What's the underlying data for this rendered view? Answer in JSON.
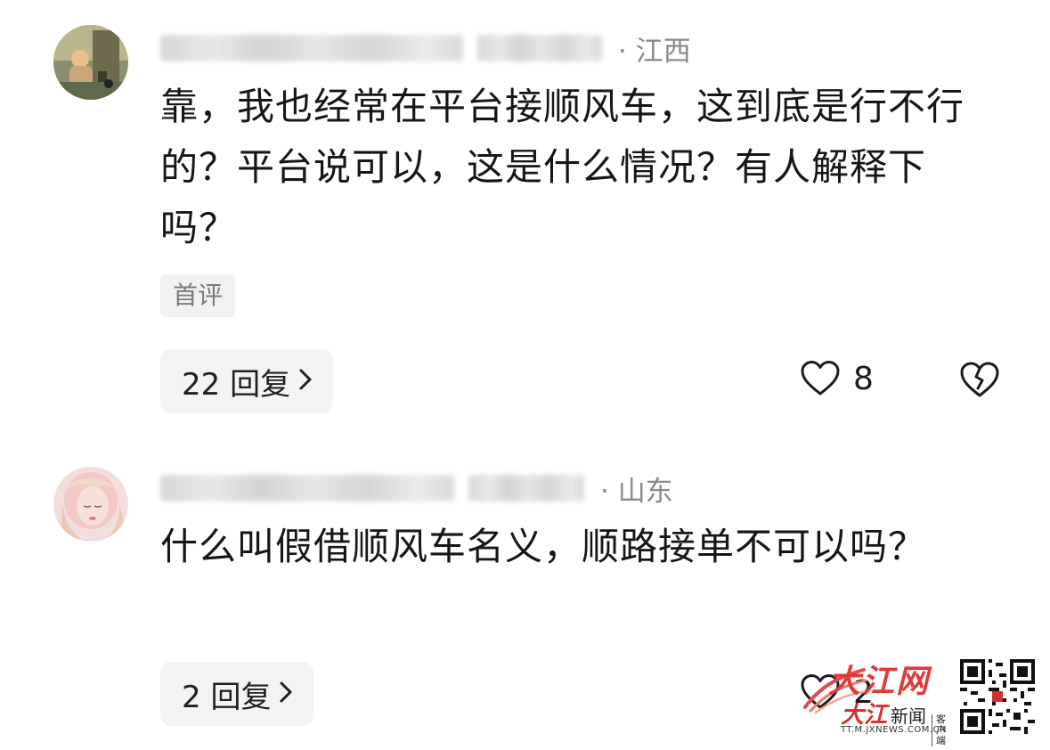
{
  "comments": [
    {
      "region": "· 江西",
      "text": "靠，我也经常在平台接顺风车，这到底是行不行的？平台说可以，这是什么情况？有人解释下吗？",
      "badge": "首评",
      "reply_count_label": "22 回复",
      "like_count": "8"
    },
    {
      "region": "· 山东",
      "text": "什么叫假借顺风车名义，顺路接单不可以吗？",
      "reply_count_label": "2 回复",
      "like_count": "2"
    }
  ],
  "watermark": {
    "logo_text": "大江网",
    "brand": "大江",
    "news": "新闻",
    "client": "客户端",
    "url": "TT.M.JXNEWS.COM.CN"
  },
  "colors": {
    "brand_red": "#d32f2f",
    "meta_gray": "#8a8a8a",
    "button_bg": "#f3f3f3"
  }
}
